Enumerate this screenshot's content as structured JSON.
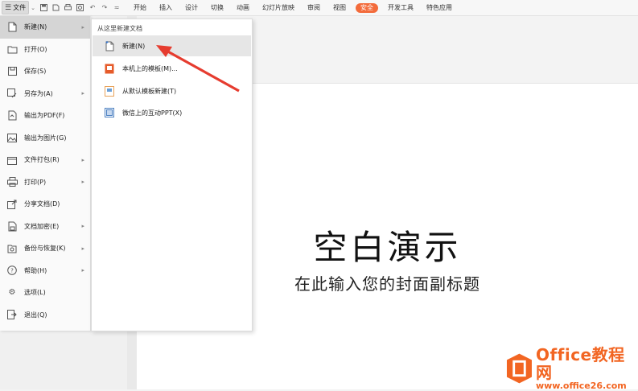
{
  "toolbar": {
    "file_label": "文件",
    "tabs": [
      "开始",
      "插入",
      "设计",
      "切换",
      "动画",
      "幻灯片放映",
      "审阅",
      "视图",
      "安全",
      "开发工具",
      "特色应用"
    ],
    "active_tab": "安全",
    "accent_color": "#f36b3b"
  },
  "file_menu": {
    "items": [
      {
        "label": "新建(N)",
        "icon": "new-doc-icon",
        "submenu": true
      },
      {
        "label": "打开(O)",
        "icon": "folder-open-icon",
        "submenu": false
      },
      {
        "label": "保存(S)",
        "icon": "save-icon",
        "submenu": false
      },
      {
        "label": "另存为(A)",
        "icon": "save-as-icon",
        "submenu": true
      },
      {
        "label": "输出为PDF(F)",
        "icon": "pdf-icon",
        "submenu": false
      },
      {
        "label": "输出为图片(G)",
        "icon": "image-icon",
        "submenu": false
      },
      {
        "label": "文件打包(R)",
        "icon": "package-icon",
        "submenu": true
      },
      {
        "label": "打印(P)",
        "icon": "print-icon",
        "submenu": true
      },
      {
        "label": "分享文档(D)",
        "icon": "share-icon",
        "submenu": false
      },
      {
        "label": "文档加密(E)",
        "icon": "lock-doc-icon",
        "submenu": true
      },
      {
        "label": "备份与恢复(K)",
        "icon": "backup-icon",
        "submenu": true
      },
      {
        "label": "帮助(H)",
        "icon": "help-icon",
        "submenu": true
      },
      {
        "label": "选项(L)",
        "icon": "gear-icon",
        "submenu": false
      },
      {
        "label": "退出(Q)",
        "icon": "exit-icon",
        "submenu": false
      }
    ]
  },
  "submenu": {
    "header": "从这里新建文档",
    "items": [
      {
        "label": "新建(N)",
        "icon": "blank-doc-icon"
      },
      {
        "label": "本机上的模板(M)...",
        "icon": "local-template-icon"
      },
      {
        "label": "从默认模板新建(T)",
        "icon": "default-template-icon"
      },
      {
        "label": "微信上的互动PPT(X)",
        "icon": "wechat-ppt-icon"
      }
    ]
  },
  "slide": {
    "title": "空白演示",
    "subtitle": "在此输入您的封面副标题"
  },
  "watermark": {
    "line1": "Office教程网",
    "line2": "www.office26.com",
    "color": "#f26522"
  }
}
